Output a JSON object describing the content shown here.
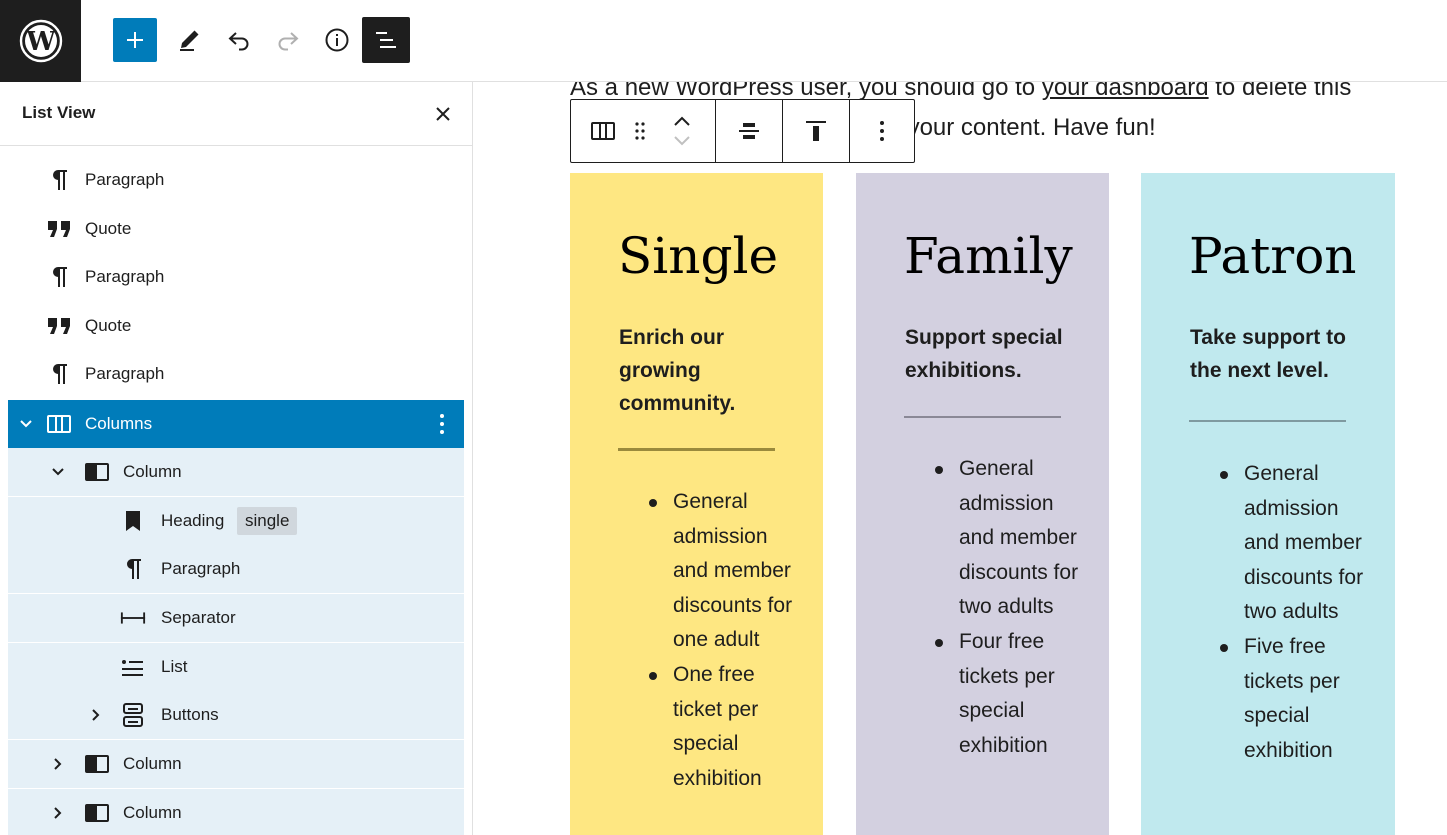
{
  "toolbar": {
    "add_label": "Add block",
    "edit_label": "Tools",
    "undo_label": "Undo",
    "redo_label": "Redo",
    "info_label": "Details",
    "list_label": "List View"
  },
  "sidebar": {
    "title": "List View",
    "items": [
      {
        "label": "Paragraph",
        "icon": "paragraph-icon"
      },
      {
        "label": "Quote",
        "icon": "quote-icon"
      },
      {
        "label": "Paragraph",
        "icon": "paragraph-icon"
      },
      {
        "label": "Quote",
        "icon": "quote-icon"
      },
      {
        "label": "Paragraph",
        "icon": "paragraph-icon"
      },
      {
        "label": "Columns",
        "icon": "columns-icon"
      },
      {
        "label": "Column",
        "icon": "column-icon"
      },
      {
        "label": "Heading",
        "icon": "heading-bookmark-icon",
        "badge": "single"
      },
      {
        "label": "Paragraph",
        "icon": "paragraph-icon"
      },
      {
        "label": "Separator",
        "icon": "separator-icon"
      },
      {
        "label": "List",
        "icon": "list-icon"
      },
      {
        "label": "Buttons",
        "icon": "buttons-icon"
      },
      {
        "label": "Column",
        "icon": "column-icon"
      },
      {
        "label": "Column",
        "icon": "column-icon"
      }
    ]
  },
  "canvas": {
    "intro_line1_pre": "As a new WordPress user, you should go to ",
    "intro_link": "your dashboard",
    "intro_line1_post": " to delete this",
    "intro_line2": "page and create new pages for your content. Have fun!",
    "columns": [
      {
        "heading": "Single",
        "subtitle": "Enrich our growing community.",
        "bg": "#fee782",
        "separator_color": "#9a8a3c",
        "list": [
          "General admission and member discounts for one adult",
          "One free ticket per special exhibition"
        ]
      },
      {
        "heading": "Family",
        "subtitle": "Support special exhibitions.",
        "bg": "#d3d0e0",
        "separator_color": "#8a8896",
        "list": [
          "General admission and member discounts for two adults",
          "Four free tickets per special exhibition"
        ]
      },
      {
        "heading": "Patron",
        "subtitle": "Take support to the next level.",
        "bg": "#c0e9ee",
        "separator_color": "#7f9aa0",
        "list": [
          "General admission and member discounts for two adults",
          "Five free tickets per special exhibition"
        ]
      }
    ]
  },
  "colors": {
    "accent": "#007cba",
    "selected_bg": "#e5f0f7",
    "dark": "#1e1e1e"
  }
}
